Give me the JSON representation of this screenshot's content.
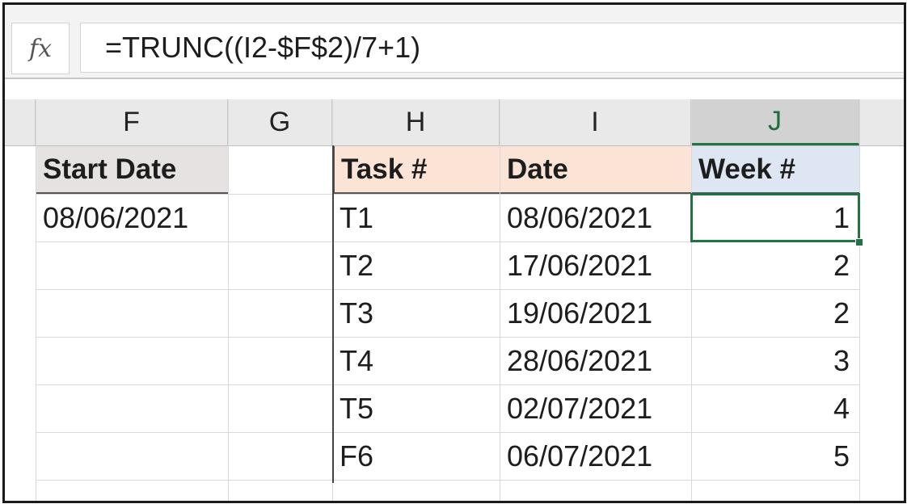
{
  "formula_bar": {
    "fx_label": "fx",
    "formula": "=TRUNC((I2-$F$2)/7+1)"
  },
  "columns": [
    "F",
    "G",
    "H",
    "I",
    "J"
  ],
  "selected_column": "J",
  "start_date": {
    "header": "Start Date",
    "value": "08/06/2021"
  },
  "table": {
    "headers": [
      "Task #",
      "Date",
      "Week #"
    ],
    "rows": [
      {
        "task": "T1",
        "date": "08/06/2021",
        "week": "1"
      },
      {
        "task": "T2",
        "date": "17/06/2021",
        "week": "2"
      },
      {
        "task": "T3",
        "date": "19/06/2021",
        "week": "2"
      },
      {
        "task": "T4",
        "date": "28/06/2021",
        "week": "3"
      },
      {
        "task": "T5",
        "date": "02/07/2021",
        "week": "4"
      },
      {
        "task": "F6",
        "date": "06/07/2021",
        "week": "5"
      }
    ]
  },
  "colors": {
    "accent": "#217346",
    "start_header_fill": "#e7e2e2",
    "task_header_fill": "#fbe4d6",
    "week_header_fill": "#dde6f2"
  }
}
